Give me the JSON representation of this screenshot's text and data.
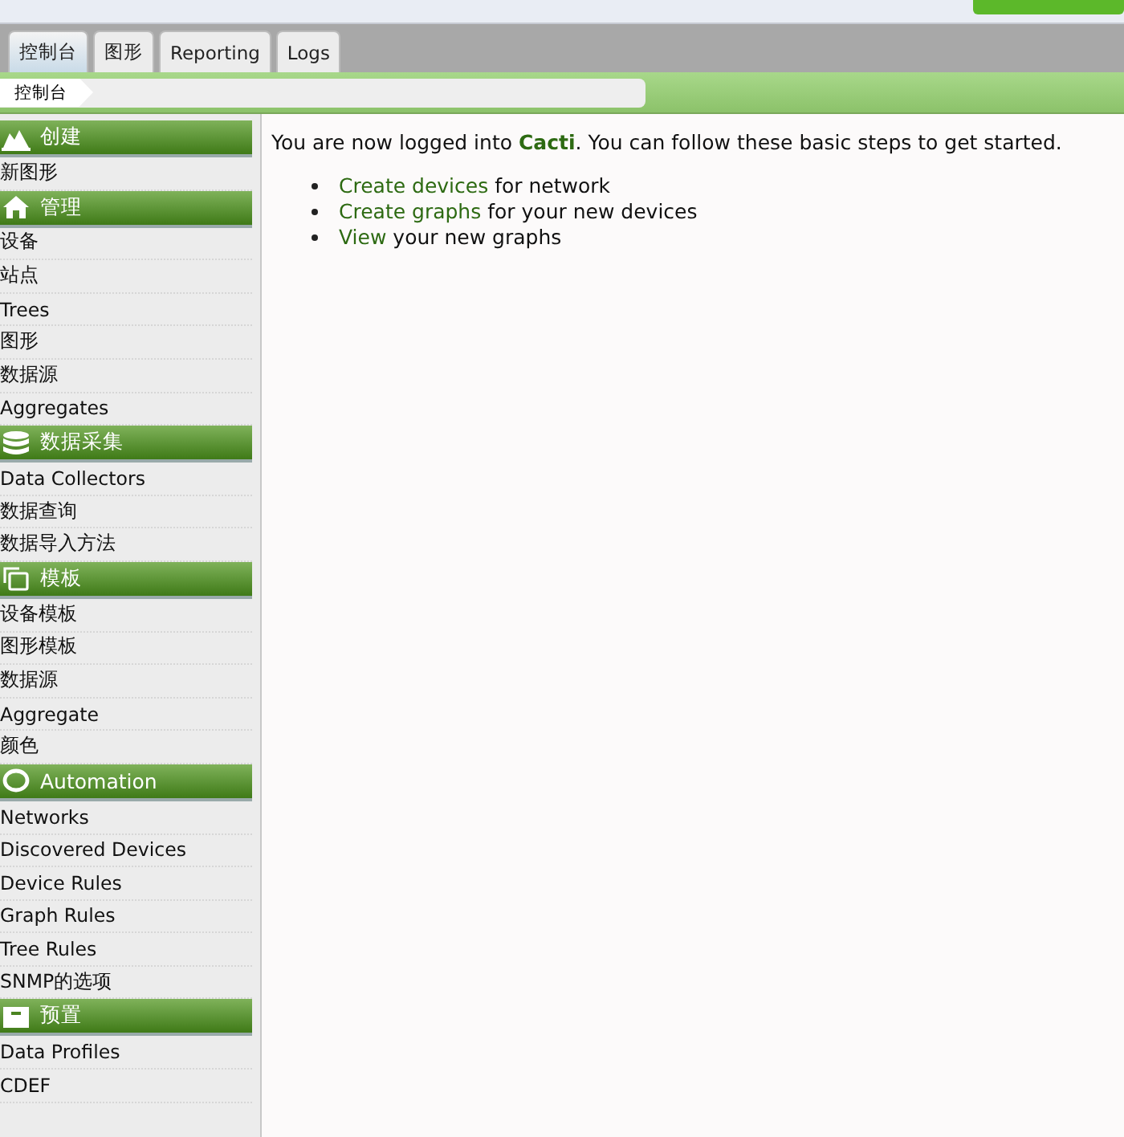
{
  "tabs": [
    {
      "label": "控制台",
      "selected": true
    },
    {
      "label": "图形",
      "selected": false
    },
    {
      "label": "Reporting",
      "selected": false
    },
    {
      "label": "Logs",
      "selected": false
    }
  ],
  "breadcrumb": [
    "控制台"
  ],
  "sidebar": [
    {
      "title": "创建",
      "items": [
        "新图形"
      ]
    },
    {
      "title": "管理",
      "items": [
        "设备",
        "站点",
        "Trees",
        "图形",
        "数据源",
        "Aggregates"
      ]
    },
    {
      "title": "数据采集",
      "items": [
        "Data Collectors",
        "数据查询",
        "数据导入方法"
      ]
    },
    {
      "title": "模板",
      "items": [
        "设备模板",
        "图形模板",
        "数据源",
        "Aggregate",
        "颜色"
      ]
    },
    {
      "title": "Automation",
      "items": [
        "Networks",
        "Discovered Devices",
        "Device Rules",
        "Graph Rules",
        "Tree Rules",
        "SNMP的选项"
      ]
    },
    {
      "title": "预置",
      "items": [
        "Data Profiles",
        "CDEF"
      ]
    }
  ],
  "intro": "You are now logged into **Cacti**. You can follow these basic steps to get started.",
  "steps": [
    {
      "link": "Create devices",
      "text": "for network"
    },
    {
      "link": "Create graphs",
      "text": "for your new devices"
    },
    {
      "link": "View",
      "text": "your new graphs"
    }
  ]
}
